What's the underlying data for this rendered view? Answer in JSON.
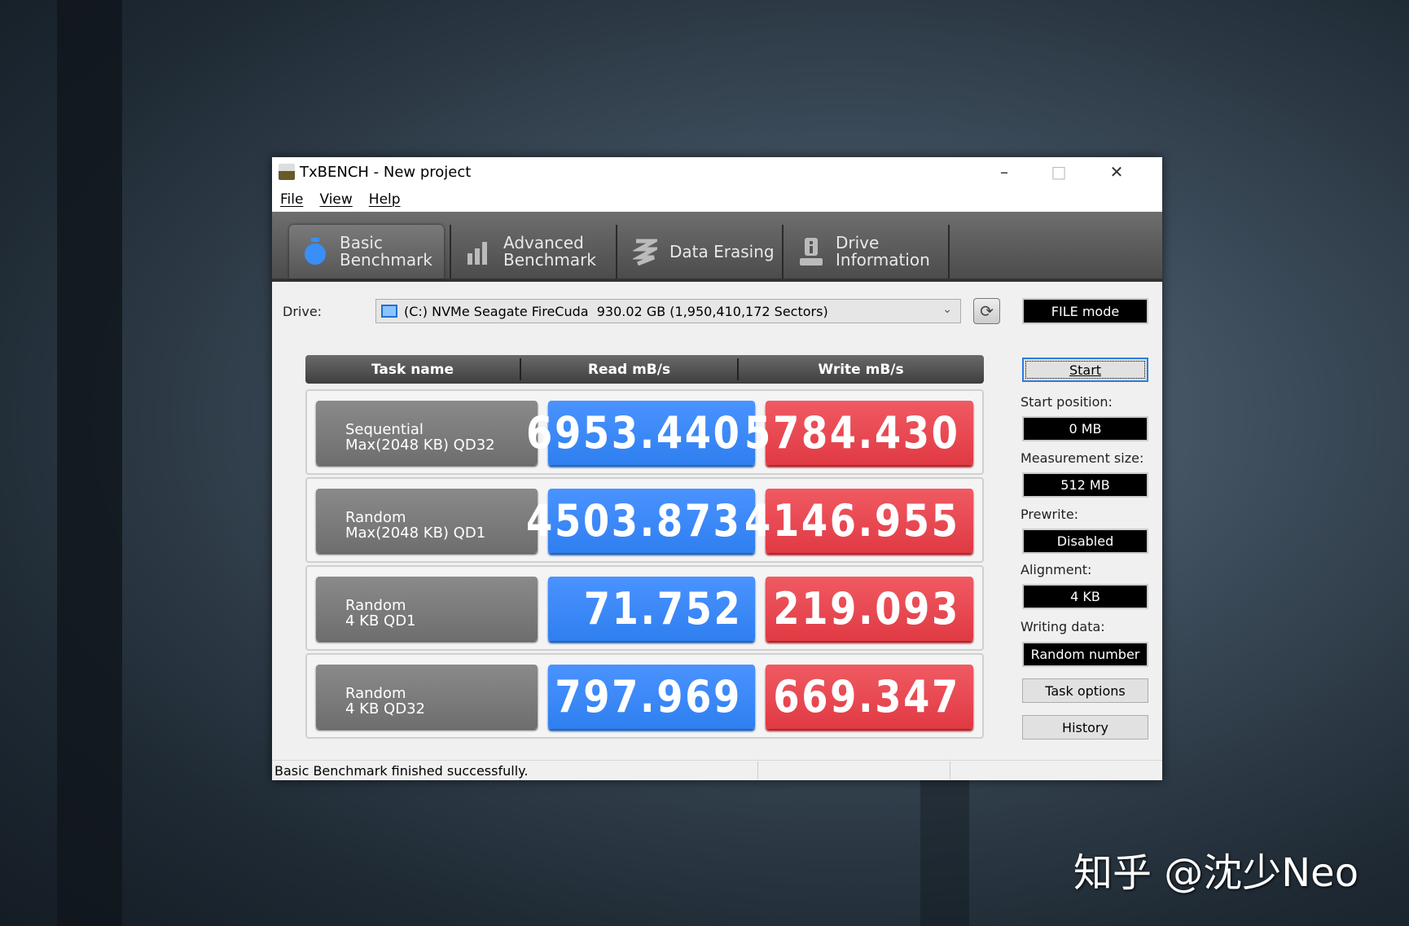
{
  "window": {
    "title": "TxBENCH - New project"
  },
  "menu": [
    "File",
    "View",
    "Help"
  ],
  "tabs": [
    {
      "label1": "Basic",
      "label2": "Benchmark",
      "icon": "stopwatch-icon",
      "active": true
    },
    {
      "label1": "Advanced",
      "label2": "Benchmark",
      "icon": "bar-chart-icon"
    },
    {
      "label1": "Data Erasing",
      "label2": "",
      "icon": "eraser-icon"
    },
    {
      "label1": "Drive",
      "label2": "Information",
      "icon": "drive-info-icon"
    }
  ],
  "drive": {
    "label": "Drive:",
    "value": "(C:) NVMe Seagate FireCuda  930.02 GB (1,950,410,172 Sectors)"
  },
  "file_mode": "FILE mode",
  "table": {
    "headers": [
      "Task name",
      "Read mB/s",
      "Write mB/s"
    ],
    "rows": [
      {
        "name1": "Sequential",
        "name2": "Max(2048 KB) QD32",
        "read": "6953.440",
        "write": "5784.430"
      },
      {
        "name1": "Random",
        "name2": "Max(2048 KB) QD1",
        "read": "4503.873",
        "write": "4146.955"
      },
      {
        "name1": "Random",
        "name2": "4 KB QD1",
        "read": "71.752",
        "write": "219.093"
      },
      {
        "name1": "Random",
        "name2": "4 KB QD32",
        "read": "797.969",
        "write": "669.347"
      }
    ]
  },
  "side": {
    "start": "Start",
    "start_position_label": "Start position:",
    "start_position": "0 MB",
    "measurement_size_label": "Measurement size:",
    "measurement_size": "512 MB",
    "prewrite_label": "Prewrite:",
    "prewrite": "Disabled",
    "alignment_label": "Alignment:",
    "alignment": "4 KB",
    "writing_data_label": "Writing data:",
    "writing_data": "Random number",
    "task_options": "Task options",
    "history": "History"
  },
  "status": "Basic Benchmark finished successfully.",
  "watermark": "知乎 @沈少Neo",
  "colors": {
    "read": "#3a88f8",
    "write": "#e8464f",
    "task": "#7c7c7c"
  }
}
